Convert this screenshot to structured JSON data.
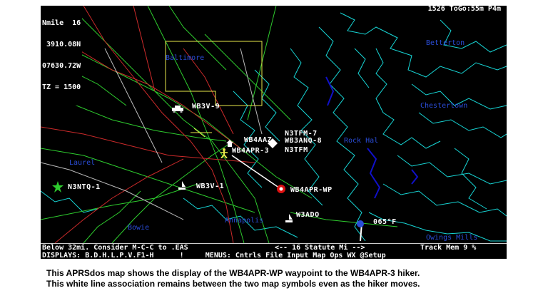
{
  "hud": {
    "top_left": [
      "Nmile  16",
      " 3910.08N",
      "07630.72W",
      "TZ = 1500"
    ],
    "top_right": "1526 ToGo:55m P4m"
  },
  "places": [
    "Baltimore",
    "Laurel",
    "Bowie",
    "Annapolis",
    "Chestertown",
    "Rock Hal",
    "Betterton",
    "Owings Mills"
  ],
  "stations": {
    "wb3v9": "WB3V-9",
    "wb4aaz": "WB4AAZ",
    "n3tfm7": "N3TFM-7",
    "wb3anq8": "WB3ANQ-8",
    "n3tfm": "N3TFM",
    "wb4apr3": "WB4APR-3",
    "wb3v1": "WB3V-1",
    "n3ntq1": "N3NTQ-1",
    "wb4aprwp": "WB4APR-WP",
    "w3ado": "W3ADO",
    "temp": "065°F"
  },
  "statusbar": {
    "line1_left": "Below 32mi. Consider M-C-C to .EAS",
    "line1_mid": "<-- 16 Statute Mi -->",
    "line1_right": "Track Mem 9 %",
    "line2": "DISPLAYS: B.D.H.L.P.V.F1-H      !     MENUS: Cntrls File Input Map Ops WX @Setup"
  },
  "caption": {
    "line1": "This APRSdos map shows the display of the WB4APR-WP waypoint to the WB4APR-3 hiker.",
    "line2": "This white line association remains between the two map symbols even as the hiker moves."
  },
  "colors": {
    "water": "#17d6d6",
    "roads": "#2ecc2e",
    "highways": "#cc2a2a",
    "county": "#e8e84a",
    "labels": "#2a4dd8",
    "bay": "#1010c8"
  }
}
